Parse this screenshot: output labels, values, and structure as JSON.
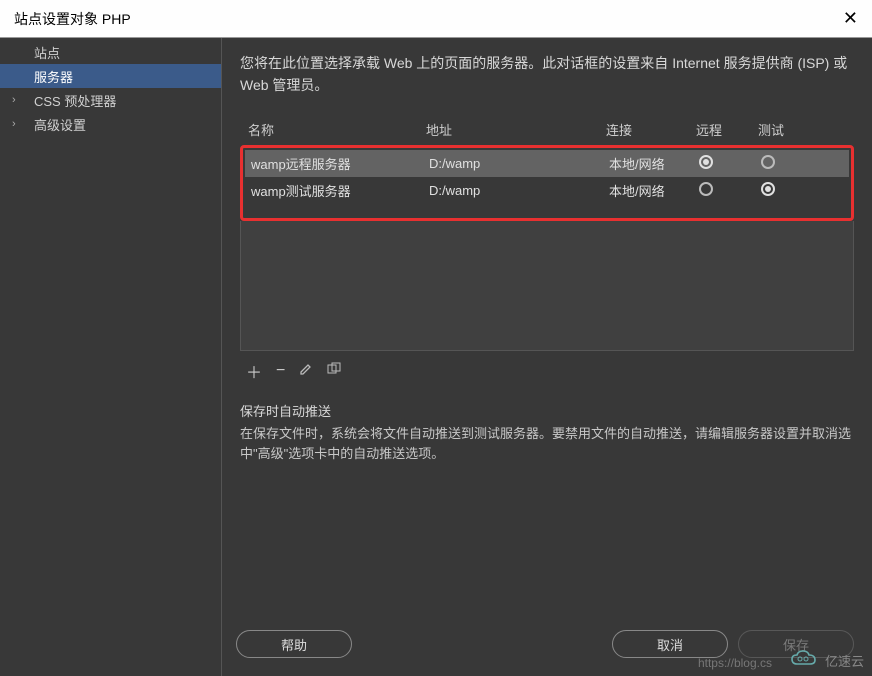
{
  "window": {
    "title": "站点设置对象 PHP"
  },
  "sidebar": {
    "items": [
      {
        "label": "站点",
        "expandable": false
      },
      {
        "label": "服务器",
        "expandable": false,
        "selected": true
      },
      {
        "label": "CSS 预处理器",
        "expandable": true
      },
      {
        "label": "高级设置",
        "expandable": true
      }
    ]
  },
  "main": {
    "description": "您将在此位置选择承载 Web 上的页面的服务器。此对话框的设置来自 Internet 服务提供商 (ISP) 或 Web 管理员。",
    "columns": {
      "name": "名称",
      "address": "地址",
      "connection": "连接",
      "remote": "远程",
      "test": "测试"
    },
    "rows": [
      {
        "name": "wamp远程服务器",
        "address": "D:/wamp",
        "connection": "本地/网络",
        "remote": true,
        "test": false
      },
      {
        "name": "wamp测试服务器",
        "address": "D:/wamp",
        "connection": "本地/网络",
        "remote": false,
        "test": true
      }
    ],
    "autopush": {
      "title": "保存时自动推送",
      "text": "在保存文件时，系统会将文件自动推送到测试服务器。要禁用文件的自动推送，请编辑服务器设置并取消选中\"高级\"选项卡中的自动推送选项。"
    }
  },
  "buttons": {
    "help": "帮助",
    "cancel": "取消",
    "save": "保存"
  },
  "watermark": {
    "url": "https://blog.cs",
    "brand": "亿速云"
  }
}
